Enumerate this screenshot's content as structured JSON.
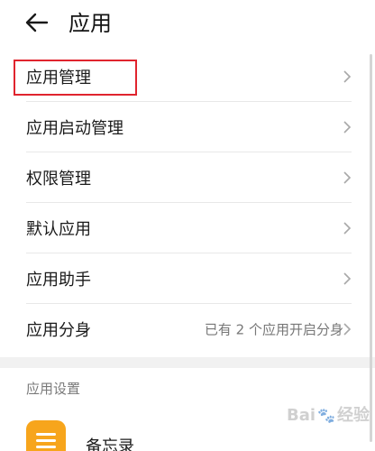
{
  "header": {
    "title": "应用",
    "back_icon": "arrow-left-icon"
  },
  "list": {
    "items": [
      {
        "label": "应用管理",
        "value": "",
        "highlighted": true
      },
      {
        "label": "应用启动管理",
        "value": ""
      },
      {
        "label": "权限管理",
        "value": ""
      },
      {
        "label": "默认应用",
        "value": ""
      },
      {
        "label": "应用助手",
        "value": ""
      },
      {
        "label": "应用分身",
        "value": "已有 2 个应用开启分身"
      }
    ]
  },
  "settings_section": {
    "title": "应用设置",
    "apps": [
      {
        "name": "备忘录",
        "icon": "notepad-icon",
        "icon_color": "#f7a51c"
      }
    ]
  },
  "watermark": {
    "text_before": "Bai",
    "text_after": "经验"
  },
  "colors": {
    "highlight": "#e0242e",
    "divider": "#e8e8e8",
    "section_bg": "#f1f1f1"
  }
}
